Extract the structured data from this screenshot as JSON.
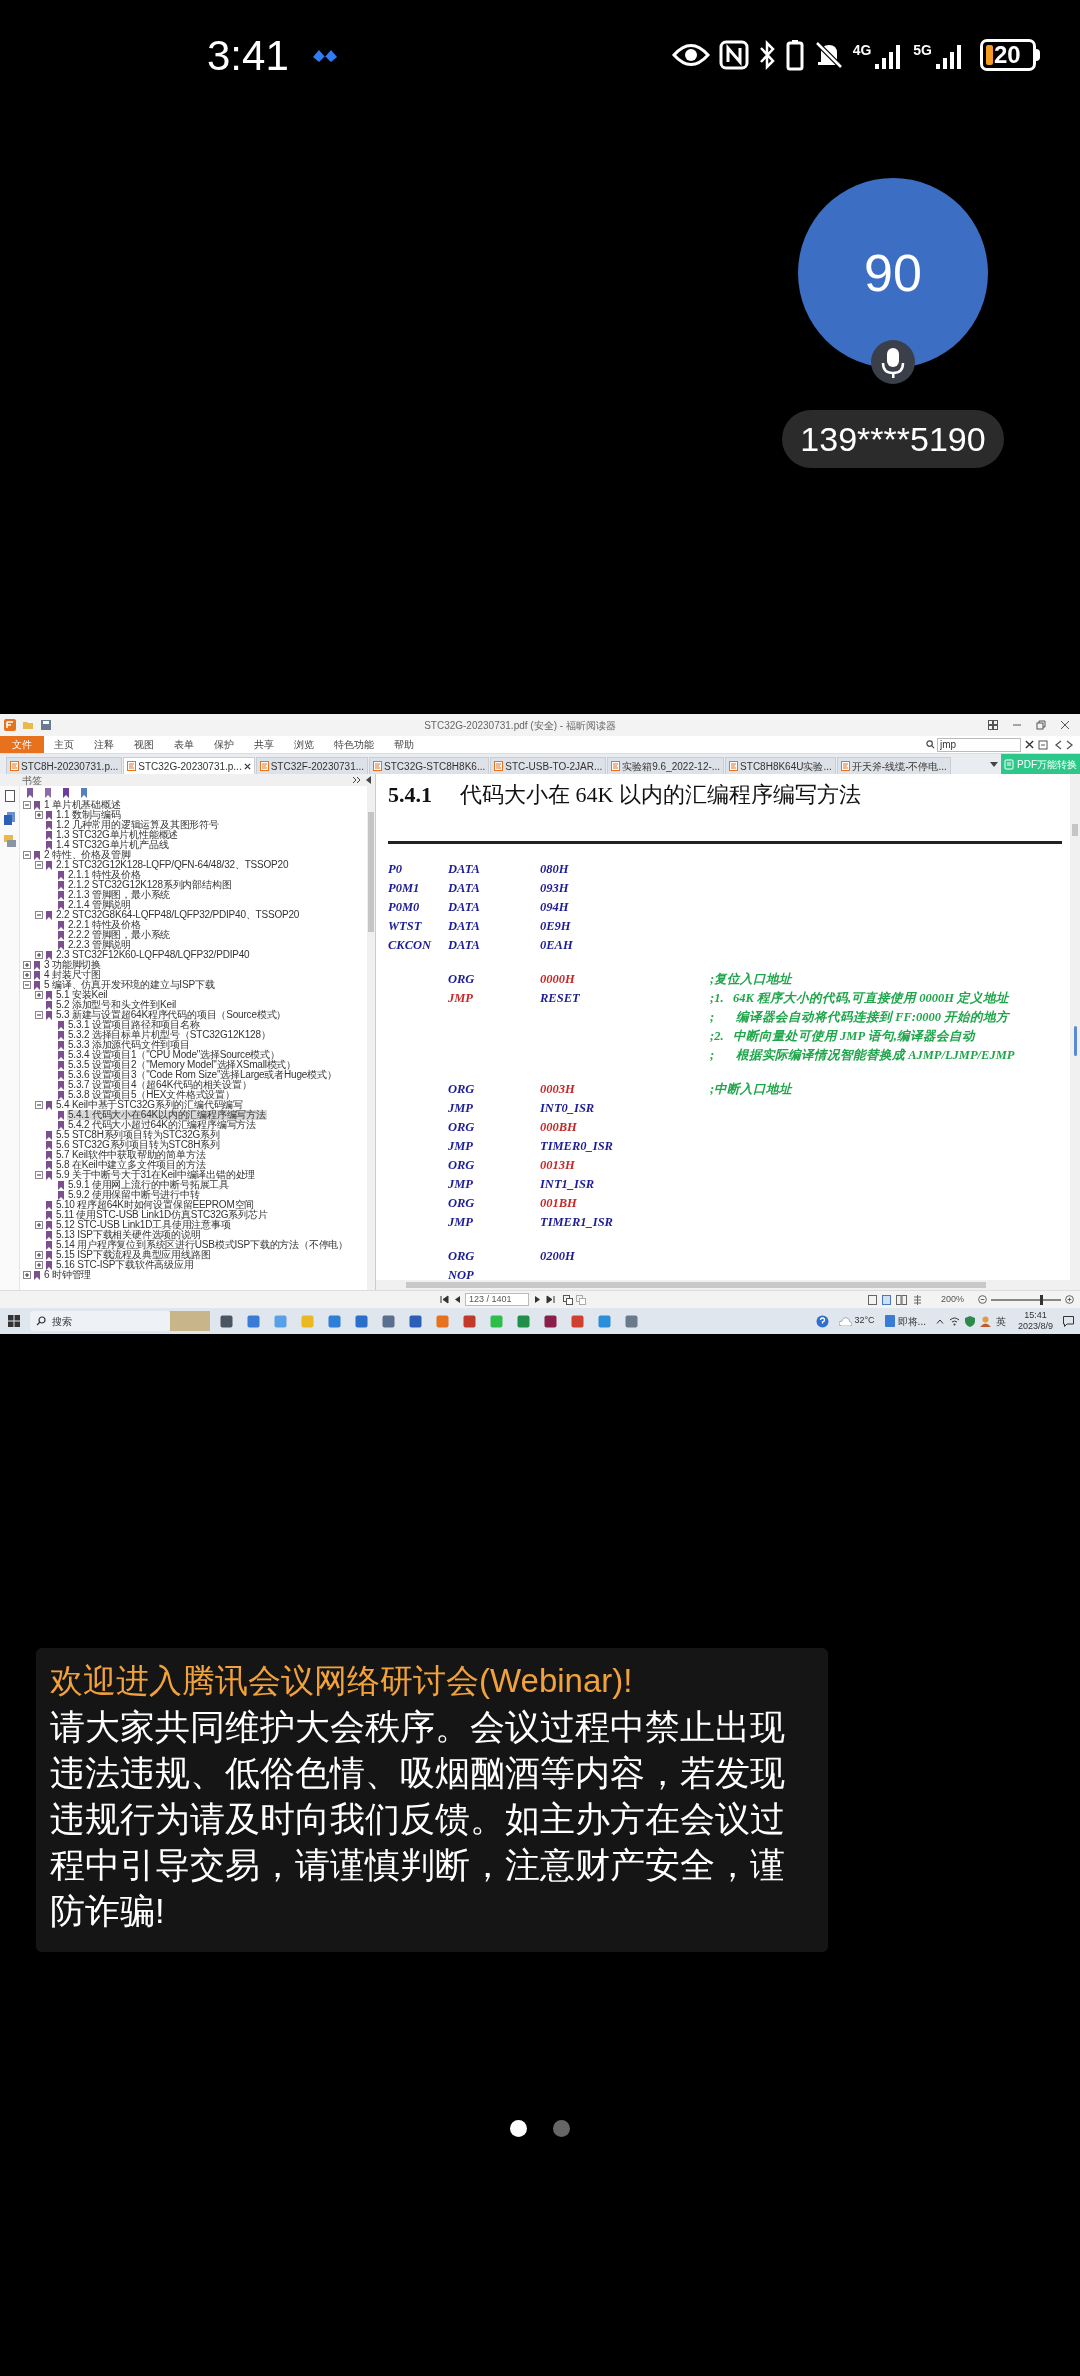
{
  "status_bar": {
    "time": "3:41",
    "network_labels": [
      "4G",
      "5G"
    ],
    "battery": "20"
  },
  "speaker": {
    "avatar_text": "90",
    "caller": "139****5190"
  },
  "shared_screen": {
    "window_title": "STC32G-20230731.pdf (安全) - 福昕阅读器",
    "file_menu": "文件",
    "menu": [
      "主页",
      "注释",
      "视图",
      "表单",
      "保护",
      "共享",
      "浏览",
      "特色功能",
      "帮助"
    ],
    "search": {
      "value": "jmp"
    },
    "doc_tabs": [
      {
        "label": "STC8H-20230731.p...",
        "selected": false
      },
      {
        "label": "STC32G-20230731.p...",
        "selected": true
      },
      {
        "label": "STC32F-20230731...",
        "selected": false
      },
      {
        "label": "STC32G-STC8H8K6...",
        "selected": false
      },
      {
        "label": "STC-USB-TO-2JAR...",
        "selected": false
      },
      {
        "label": "实验箱9.6_2022-12-...",
        "selected": false
      },
      {
        "label": "STC8H8K64U实验...",
        "selected": false
      },
      {
        "label": "开天斧-线缆-不停电...",
        "selected": false
      }
    ],
    "convert_button": "PDF万能转换",
    "bookmarks": {
      "title": "书签",
      "items": [
        {
          "label": "1 单片机基础概述",
          "selected": false,
          "expanded": true,
          "children": [
            {
              "label": "1.1 数制与编码",
              "selected": false,
              "expanded": false
            },
            {
              "label": "1.2 几种常用的逻辑运算及其图形符号",
              "selected": false
            },
            {
              "label": "1.3 STC32G单片机性能概述",
              "selected": false
            },
            {
              "label": "1.4 STC32G单片机产品线",
              "selected": false
            }
          ]
        },
        {
          "label": "2 特性、价格及管脚",
          "selected": false,
          "expanded": true,
          "children": [
            {
              "label": "2.1 STC32G12K128-LQFP/QFN-64/48/32、TSSOP20",
              "selected": false,
              "expanded": true,
              "children": [
                {
                  "label": "2.1.1 特性及价格",
                  "selected": false
                },
                {
                  "label": "2.1.2 STC32G12K128系列内部结构图",
                  "selected": false
                },
                {
                  "label": "2.1.3 管脚图，最小系统",
                  "selected": false
                },
                {
                  "label": "2.1.4 管脚说明",
                  "selected": false
                }
              ]
            },
            {
              "label": "2.2 STC32G8K64-LQFP48/LQFP32/PDIP40、TSSOP20",
              "selected": false,
              "expanded": true,
              "children": [
                {
                  "label": "2.2.1 特性及价格",
                  "selected": false
                },
                {
                  "label": "2.2.2 管脚图，最小系统",
                  "selected": false
                },
                {
                  "label": "2.2.3 管脚说明",
                  "selected": false
                }
              ]
            },
            {
              "label": "2.3 STC32F12K60-LQFP48/LQFP32/PDIP40",
              "selected": false,
              "expanded": false
            }
          ]
        },
        {
          "label": "3 功能脚切换",
          "selected": false,
          "expanded": false
        },
        {
          "label": "4 封装尺寸图",
          "selected": false,
          "expanded": false
        },
        {
          "label": "5 编译、仿真开发环境的建立与ISP下载",
          "selected": false,
          "expanded": true,
          "children": [
            {
              "label": "5.1 安装Keil",
              "selected": false,
              "expanded": false
            },
            {
              "label": "5.2 添加型号和头文件到Keil",
              "selected": false
            },
            {
              "label": "5.3 新建与设置超64K程序代码的项目（Source模式）",
              "selected": false,
              "expanded": true,
              "children": [
                {
                  "label": "5.3.1 设置项目路径和项目名称",
                  "selected": false
                },
                {
                  "label": "5.3.2 选择目标单片机型号（STC32G12K128）",
                  "selected": false
                },
                {
                  "label": "5.3.3 添加源代码文件到项目",
                  "selected": false
                },
                {
                  "label": "5.3.4 设置项目1（\"CPU Mode\"选择Source模式）",
                  "selected": false
                },
                {
                  "label": "5.3.5 设置项目2（\"Memory Model\"选择XSmall模式）",
                  "selected": false
                },
                {
                  "label": "5.3.6 设置项目3（\"Code Rom Size\"选择Large或者Huge模式）",
                  "selected": false
                },
                {
                  "label": "5.3.7 设置项目4（超64K代码的相关设置）",
                  "selected": false
                },
                {
                  "label": "5.3.8 设置项目5（HEX文件格式设置）",
                  "selected": false
                }
              ]
            },
            {
              "label": "5.4 Keil中基于STC32G系列的汇编代码编写",
              "selected": false,
              "expanded": true,
              "children": [
                {
                  "label": "5.4.1 代码大小在64K以内的汇编程序编写方法",
                  "selected": true
                },
                {
                  "label": "5.4.2 代码大小超过64K的汇编程序编写方法",
                  "selected": false
                }
              ]
            },
            {
              "label": "5.5 STC8H系列项目转为STC32G系列",
              "selected": false
            },
            {
              "label": "5.6 STC32G系列项目转为STC8H系列",
              "selected": false
            },
            {
              "label": "5.7 Keil软件中获取帮助的简单方法",
              "selected": false
            },
            {
              "label": "5.8 在Keil中建立多文件项目的方法",
              "selected": false
            },
            {
              "label": "5.9 关于中断号大于31在Keil中编译出错的处理",
              "selected": false,
              "expanded": true,
              "children": [
                {
                  "label": "5.9.1 使用网上流行的中断号拓展工具",
                  "selected": false
                },
                {
                  "label": "5.9.2 使用保留中断号进行中转",
                  "selected": false
                }
              ]
            },
            {
              "label": "5.10 程序超64K时如何设置保留EEPROM空间",
              "selected": false
            },
            {
              "label": "5.11 使用STC-USB Link1D仿真STC32G系列芯片",
              "selected": false
            },
            {
              "label": "5.12 STC-USB Link1D工具使用注意事项",
              "selected": false,
              "expanded": false
            },
            {
              "label": "5.13 ISP下载相关硬件选项的说明",
              "selected": false
            },
            {
              "label": "5.14 用户程序复位到系统区进行USB模式ISP下载的方法（不停电）",
              "selected": false
            },
            {
              "label": "5.15 ISP下载流程及典型应用线路图",
              "selected": false,
              "expanded": false
            },
            {
              "label": "5.16 STC-ISP下载软件高级应用",
              "selected": false,
              "expanded": false
            }
          ]
        },
        {
          "label": "6 时钟管理",
          "selected": false,
          "expanded": false
        }
      ]
    },
    "document": {
      "heading_number": "5.4.1",
      "heading": "代码大小在 64K 以内的汇编程序编写方法",
      "code": [
        {
          "kind": "line",
          "label": "P0",
          "op": "DATA",
          "op_highlight": false,
          "operand": "080H",
          "operand_highlight": false
        },
        {
          "kind": "line",
          "label": "P0M1",
          "op": "DATA",
          "op_highlight": false,
          "operand": "093H",
          "operand_highlight": false
        },
        {
          "kind": "line",
          "label": "P0M0",
          "op": "DATA",
          "op_highlight": false,
          "operand": "094H",
          "operand_highlight": false
        },
        {
          "kind": "line",
          "label": "WTST",
          "op": "DATA",
          "op_highlight": false,
          "operand": "0E9H",
          "operand_highlight": false
        },
        {
          "kind": "line",
          "label": "CKCON",
          "op": "DATA",
          "op_highlight": false,
          "operand": "0EAH",
          "operand_highlight": false
        },
        {
          "kind": "blank"
        },
        {
          "kind": "line",
          "op": "ORG",
          "op_highlight": false,
          "operand": "0000H",
          "operand_highlight": true,
          "comment": ";复位入口地址"
        },
        {
          "kind": "line",
          "op": "JMP",
          "op_highlight": true,
          "operand": "RESET",
          "operand_highlight": false,
          "comment": ";1.   64K 程序大小的代码,可直接使用 0000H 定义地址"
        },
        {
          "kind": "line",
          "comment": ";       编译器会自动将代码连接到 FF:0000 开始的地方"
        },
        {
          "kind": "line",
          "comment": ";2.   中断向量处可使用 JMP 语句,编译器会自动"
        },
        {
          "kind": "line",
          "comment": ";       根据实际编译情况智能替换成 AJMP/LJMP/EJMP"
        },
        {
          "kind": "blank"
        },
        {
          "kind": "line",
          "op": "ORG",
          "op_highlight": false,
          "operand": "0003H",
          "operand_highlight": true,
          "comment": ";中断入口地址"
        },
        {
          "kind": "line",
          "op": "JMP",
          "op_highlight": false,
          "operand": "INT0_ISR",
          "operand_highlight": false
        },
        {
          "kind": "line",
          "op": "ORG",
          "op_highlight": false,
          "operand": "000BH",
          "operand_highlight": true
        },
        {
          "kind": "line",
          "op": "JMP",
          "op_highlight": false,
          "operand": "TIMER0_ISR",
          "operand_highlight": false
        },
        {
          "kind": "line",
          "op": "ORG",
          "op_highlight": false,
          "operand": "0013H",
          "operand_highlight": true
        },
        {
          "kind": "line",
          "op": "JMP",
          "op_highlight": false,
          "operand": "INT1_ISR",
          "operand_highlight": false
        },
        {
          "kind": "line",
          "op": "ORG",
          "op_highlight": false,
          "operand": "001BH",
          "operand_highlight": true
        },
        {
          "kind": "line",
          "op": "JMP",
          "op_highlight": false,
          "operand": "TIMER1_ISR",
          "operand_highlight": false
        },
        {
          "kind": "blank"
        },
        {
          "kind": "line",
          "op": "ORG",
          "op_highlight": false,
          "operand": "0200H",
          "operand_highlight": false
        },
        {
          "kind": "line",
          "op": "NOP",
          "op_highlight": false
        }
      ]
    },
    "page_nav": {
      "page": "123 / 1401",
      "zoom": "200%",
      "zoom_slider": {
        "level": 0.7
      }
    },
    "taskbar": {
      "search": "搜索",
      "weather": "32°C",
      "notification": "即将...",
      "ime": "英",
      "time": "15:41",
      "date": "2023/8/9"
    }
  },
  "notice": {
    "title": "欢迎进入腾讯会议网络研讨会(Webinar)!",
    "body": "请大家共同维护大会秩序。会议过程中禁止出现违法违规、低俗色情、吸烟酗酒等内容，若发现违规行为请及时向我们反馈。如主办方在会议过程中引导交易，请谨慎判断，注意财产安全，谨防诈骗!"
  },
  "pager": [
    {
      "selected": true
    },
    {
      "selected": false
    }
  ]
}
